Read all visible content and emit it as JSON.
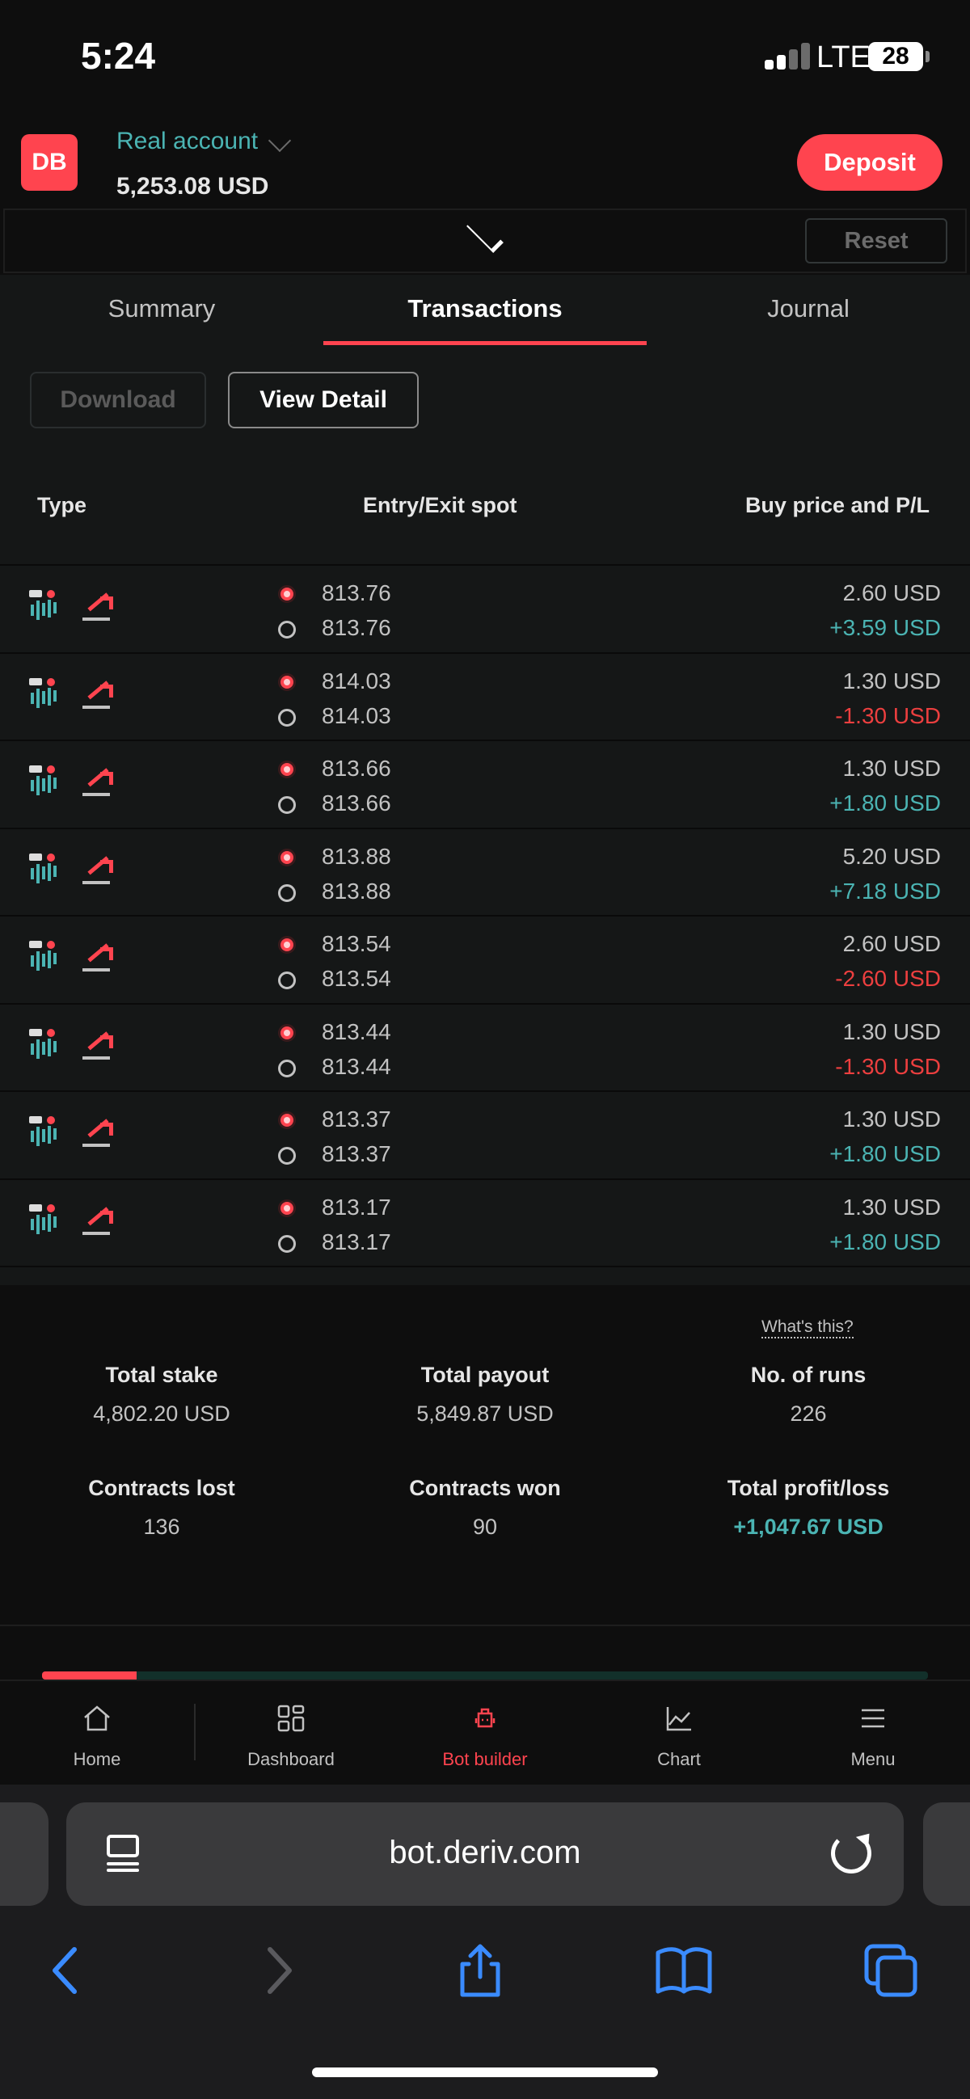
{
  "status_bar": {
    "time": "5:24",
    "network": "LTE",
    "battery": "28"
  },
  "header": {
    "logo": "DB",
    "account_type": "Real account",
    "balance": "5,253.08 USD",
    "deposit_label": "Deposit"
  },
  "toolbar": {
    "reset_label": "Reset"
  },
  "tabs": [
    {
      "label": "Summary"
    },
    {
      "label": "Transactions"
    },
    {
      "label": "Journal"
    }
  ],
  "actions": {
    "download_label": "Download",
    "view_detail_label": "View Detail"
  },
  "table": {
    "headers": {
      "type": "Type",
      "spot": "Entry/Exit spot",
      "price": "Buy price and P/L"
    },
    "rows": [
      {
        "entry": "813.76",
        "exit": "813.76",
        "buy": "2.60 USD",
        "pl": "+3.59 USD"
      },
      {
        "entry": "814.03",
        "exit": "814.03",
        "buy": "1.30 USD",
        "pl": "-1.30 USD"
      },
      {
        "entry": "813.66",
        "exit": "813.66",
        "buy": "1.30 USD",
        "pl": "+1.80 USD"
      },
      {
        "entry": "813.88",
        "exit": "813.88",
        "buy": "5.20 USD",
        "pl": "+7.18 USD"
      },
      {
        "entry": "813.54",
        "exit": "813.54",
        "buy": "2.60 USD",
        "pl": "-2.60 USD"
      },
      {
        "entry": "813.44",
        "exit": "813.44",
        "buy": "1.30 USD",
        "pl": "-1.30 USD"
      },
      {
        "entry": "813.37",
        "exit": "813.37",
        "buy": "1.30 USD",
        "pl": "+1.80 USD"
      },
      {
        "entry": "813.17",
        "exit": "813.17",
        "buy": "1.30 USD",
        "pl": "+1.80 USD"
      }
    ]
  },
  "stats": {
    "whats_this": "What's this?",
    "total_stake_label": "Total stake",
    "total_stake": "4,802.20 USD",
    "total_payout_label": "Total payout",
    "total_payout": "5,849.87 USD",
    "runs_label": "No. of runs",
    "runs": "226",
    "lost_label": "Contracts lost",
    "lost": "136",
    "won_label": "Contracts won",
    "won": "90",
    "pl_label": "Total profit/loss",
    "pl": "+1,047.67 USD"
  },
  "progress_fraction": 0.107,
  "bottom_nav": [
    {
      "label": "Home",
      "icon": "home-icon"
    },
    {
      "label": "Dashboard",
      "icon": "dashboard-icon"
    },
    {
      "label": "Bot builder",
      "icon": "bot-builder-icon"
    },
    {
      "label": "Chart",
      "icon": "chart-icon"
    },
    {
      "label": "Menu",
      "icon": "menu-icon"
    }
  ],
  "browser": {
    "url": "bot.deriv.com"
  },
  "colors": {
    "brand_red": "#ff444f",
    "positive": "#4bb4b3",
    "negative": "#ec3f3f",
    "background": "#0e0e0e",
    "panel": "#151717"
  }
}
